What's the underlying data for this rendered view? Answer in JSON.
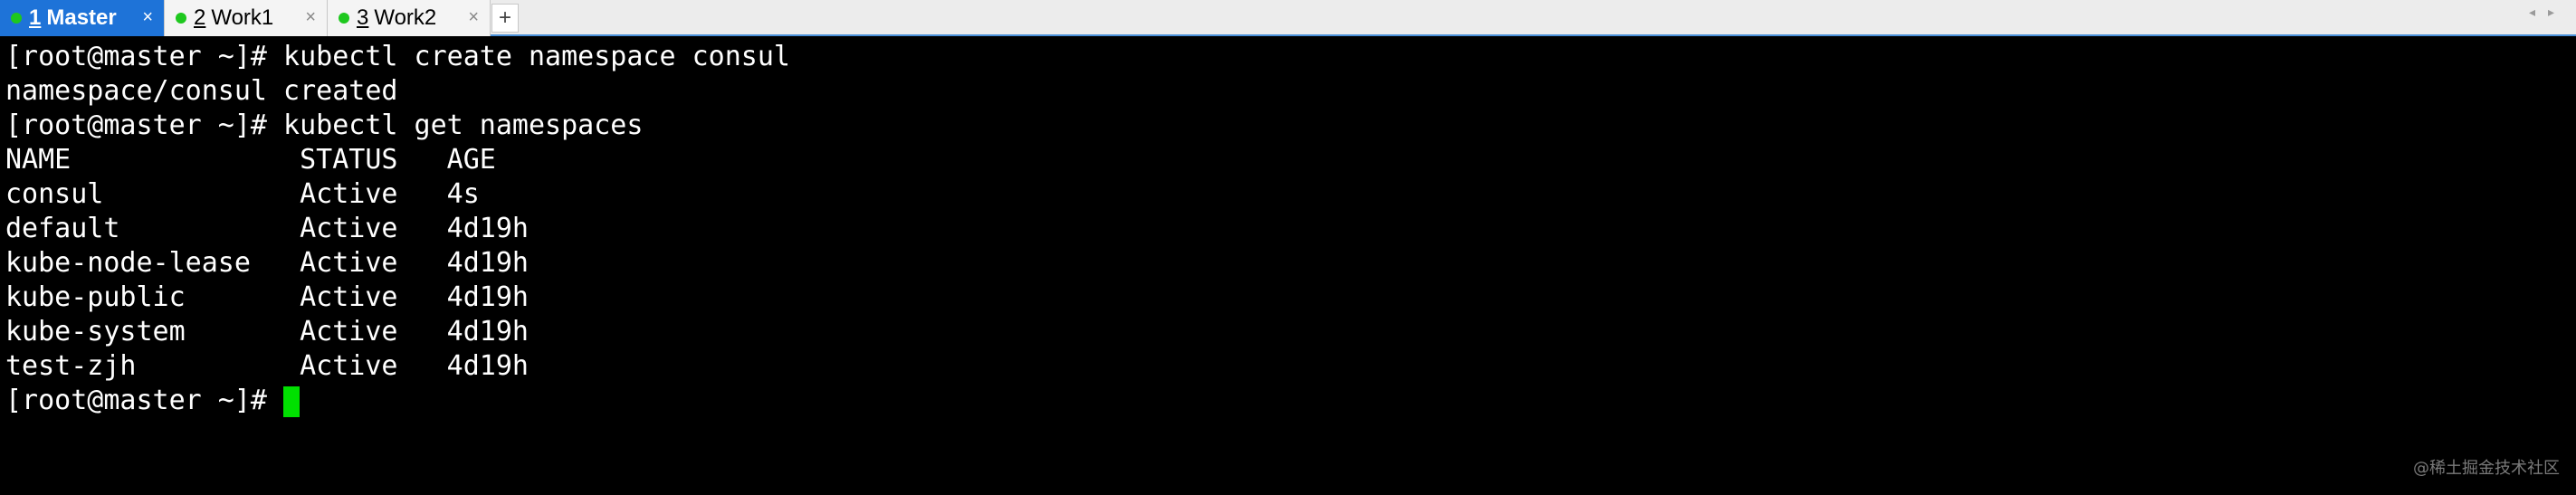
{
  "tabs": [
    {
      "number": "1",
      "label": "Master",
      "active": true,
      "close": "×"
    },
    {
      "number": "2",
      "label": "Work1",
      "active": false,
      "close": "×"
    },
    {
      "number": "3",
      "label": "Work2",
      "active": false,
      "close": "×"
    }
  ],
  "new_tab_label": "+",
  "scroll_arrows": "◂▸",
  "terminal": {
    "lines": [
      "[root@master ~]# kubectl create namespace consul",
      "namespace/consul created",
      "[root@master ~]# kubectl get namespaces",
      "NAME              STATUS   AGE",
      "consul            Active   4s",
      "default           Active   4d19h",
      "kube-node-lease   Active   4d19h",
      "kube-public       Active   4d19h",
      "kube-system       Active   4d19h",
      "test-zjh          Active   4d19h"
    ],
    "prompt": "[root@master ~]# "
  },
  "watermark": "@稀土掘金技术社区",
  "colors": {
    "active_tab": "#1e73d8",
    "status_dot": "#1ec81e",
    "cursor": "#00e000",
    "terminal_bg": "#000000",
    "terminal_fg": "#ffffff"
  }
}
